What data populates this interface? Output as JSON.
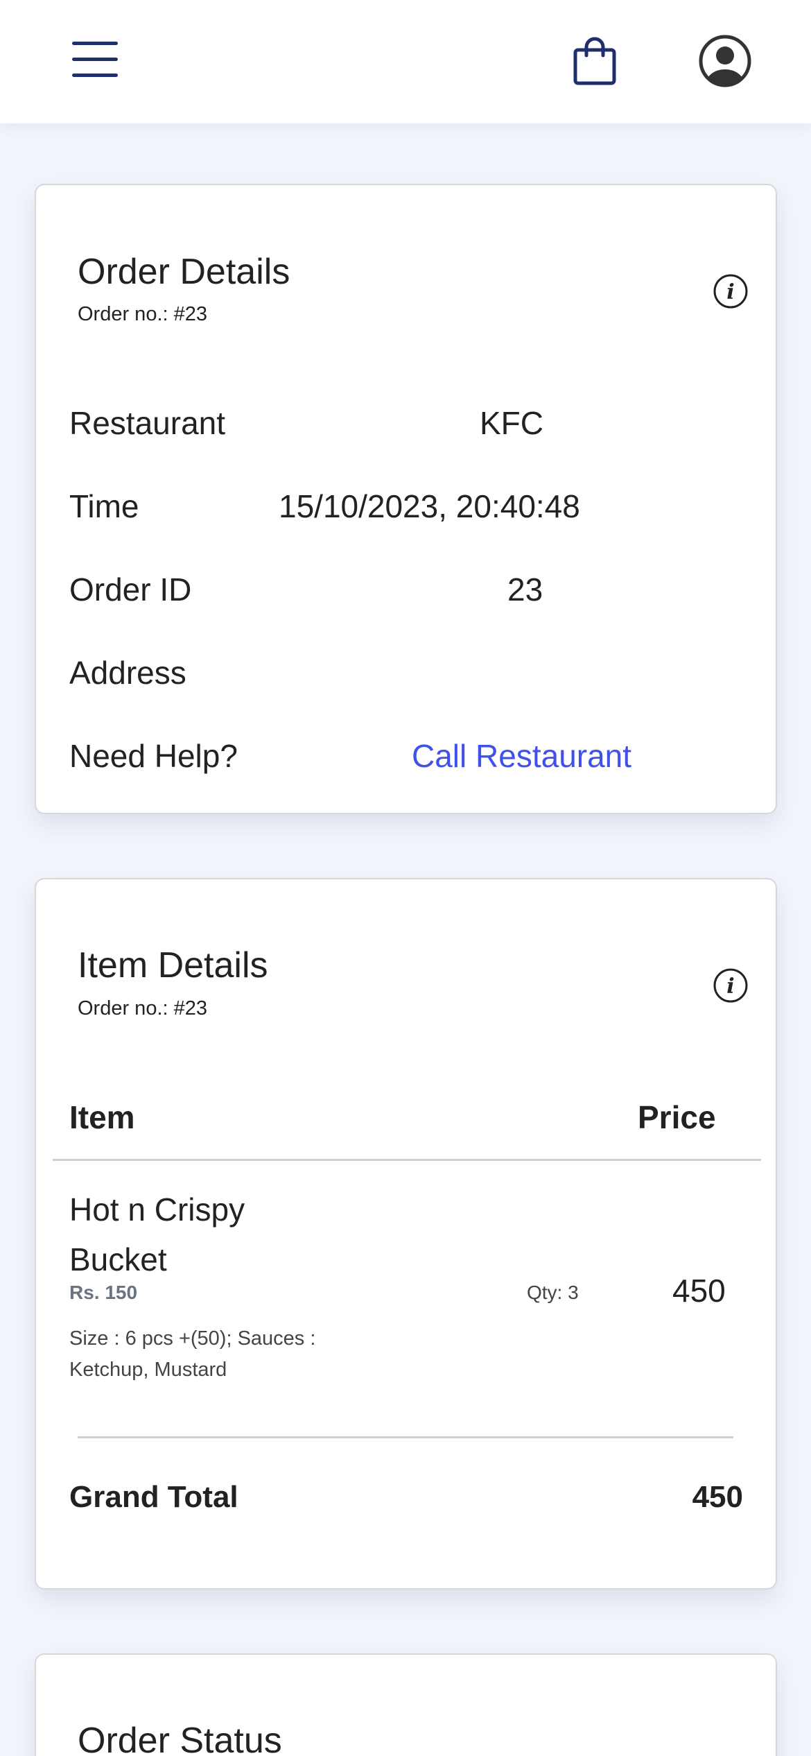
{
  "header": {
    "menu_icon": "hamburger-menu-icon",
    "cart_icon": "shopping-bag-icon",
    "profile_icon": "user-circle-icon",
    "icon_color": "#1f2f6b"
  },
  "order_details": {
    "title": "Order Details",
    "order_no": "Order no.: #23",
    "info_icon": "info-icon",
    "rows": [
      {
        "label": "Restaurant",
        "value": "KFC"
      },
      {
        "label": "Time",
        "value": "15/10/2023, 20:40:48"
      },
      {
        "label": "Order ID",
        "value": "23"
      },
      {
        "label": "Address",
        "value": ""
      },
      {
        "label": "Need Help?",
        "value": "Call Restaurant"
      }
    ],
    "link_color": "#3f51ea"
  },
  "item_details": {
    "title": "Item Details",
    "order_no": "Order no.: #23",
    "info_icon": "info-icon",
    "col_item": "Item",
    "col_price": "Price",
    "items": [
      {
        "name": "Hot n Crispy Bucket",
        "unit_price": "Rs. 150",
        "options": "Size : 6 pcs +(50); Sauces : Ketchup, Mustard",
        "qty": "Qty: 3",
        "price": "450"
      }
    ],
    "grand_total_label": "Grand Total",
    "grand_total_value": "450"
  },
  "order_status": {
    "title": "Order Status"
  }
}
